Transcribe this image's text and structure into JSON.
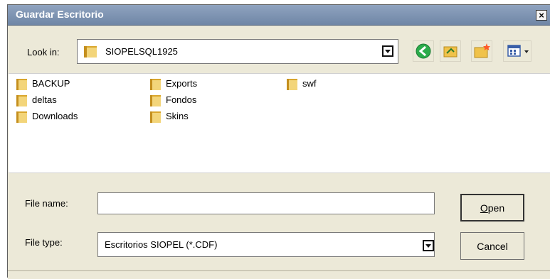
{
  "window": {
    "title": "Guardar Escritorio",
    "close_label": "×"
  },
  "lookin": {
    "label": "Look in:",
    "value": "SIOPELSQL1925",
    "folder_icon": "folder-icon",
    "dropdown_icon": "chevron-down-icon"
  },
  "toolbar": {
    "back_icon": "back-arrow-icon",
    "up_icon": "up-folder-icon",
    "newfolder_icon": "new-folder-icon",
    "view_icon": "view-menu-icon"
  },
  "files": {
    "items": [
      {
        "name": "BACKUP"
      },
      {
        "name": "deltas"
      },
      {
        "name": "Downloads"
      },
      {
        "name": "Exports"
      },
      {
        "name": "Fondos"
      },
      {
        "name": "Skins"
      },
      {
        "name": "swf"
      }
    ]
  },
  "filename": {
    "label": "File name:",
    "value": ""
  },
  "filetype": {
    "label": "File type:",
    "value": "Escritorios SIOPEL (*.CDF)"
  },
  "buttons": {
    "open_mnemonic": "O",
    "open_rest": "pen",
    "cancel": "Cancel"
  },
  "colors": {
    "titlebar": "#7f94b3",
    "folder": "#e8c055",
    "back_button": "#2bab4a"
  }
}
